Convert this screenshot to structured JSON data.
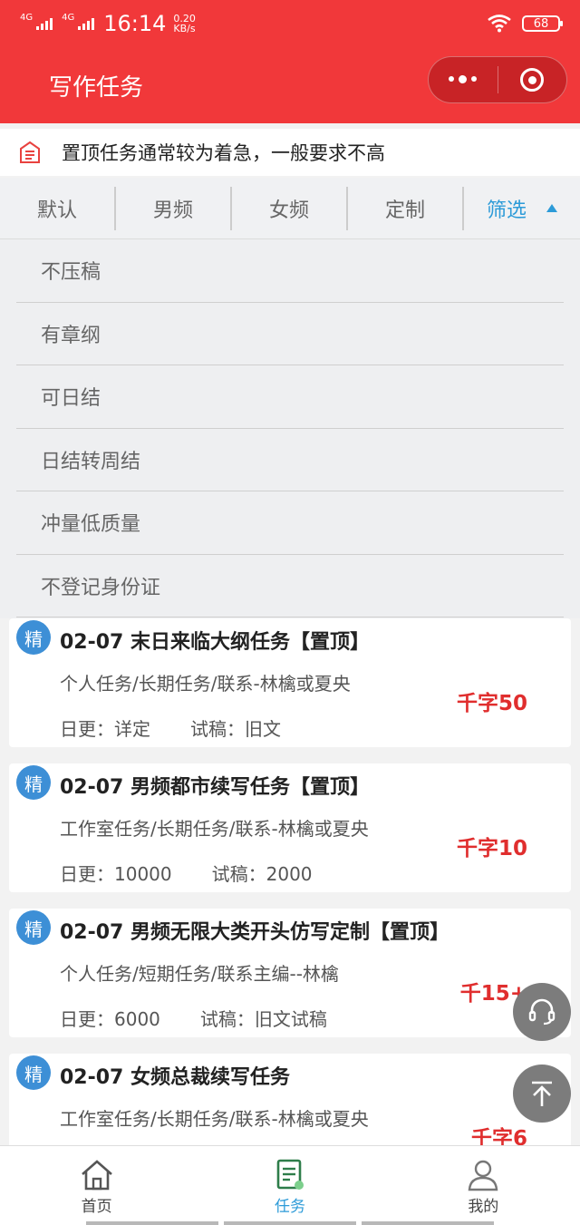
{
  "status_bar": {
    "net1": "4G",
    "net2": "4G",
    "time": "16:14",
    "speed_value": "0.20",
    "speed_unit": "KB/s",
    "battery": "68"
  },
  "nav": {
    "title": "写作任务"
  },
  "notice": {
    "text": "置顶任务通常较为着急，一般要求不高"
  },
  "tabs": [
    {
      "label": "默认"
    },
    {
      "label": "男频"
    },
    {
      "label": "女频"
    },
    {
      "label": "定制"
    },
    {
      "label": "筛选"
    }
  ],
  "filter_options": [
    {
      "label": "不压稿"
    },
    {
      "label": "有章纲"
    },
    {
      "label": "可日结"
    },
    {
      "label": "日结转周结"
    },
    {
      "label": "冲量低质量"
    },
    {
      "label": "不登记身份证"
    }
  ],
  "tasks": [
    {
      "badge": "精",
      "title": "02-07  末日来临大纲任务【置顶】",
      "meta": "个人任务/长期任务/联系-林檎或夏央",
      "daily": "日更：详定",
      "trial": "试稿：旧文",
      "price": "千字50"
    },
    {
      "badge": "精",
      "title": "02-07  男频都市续写任务【置顶】",
      "meta": "工作室任务/长期任务/联系-林檎或夏央",
      "daily": "日更：10000",
      "trial": "试稿：2000",
      "price": "千字10"
    },
    {
      "badge": "精",
      "title": "02-07  男频无限大类开头仿写定制【置顶】",
      "meta": "个人任务/短期任务/联系主编--林檎",
      "daily": "日更：6000",
      "trial": "试稿：旧文试稿",
      "price": "千15+"
    },
    {
      "badge": "精",
      "title": "02-07  女频总裁续写任务",
      "meta": "工作室任务/长期任务/联系-林檎或夏央",
      "daily": "",
      "trial": "",
      "price": "千字6"
    }
  ],
  "bottom_nav": [
    {
      "label": "首页",
      "icon": "home-icon"
    },
    {
      "label": "任务",
      "icon": "task-icon"
    },
    {
      "label": "我的",
      "icon": "profile-icon"
    }
  ],
  "colors": {
    "brand_red": "#f1383a",
    "accent_blue": "#2d9bd8",
    "price_red": "#e02e2e",
    "badge_blue": "#3d8fd6"
  }
}
